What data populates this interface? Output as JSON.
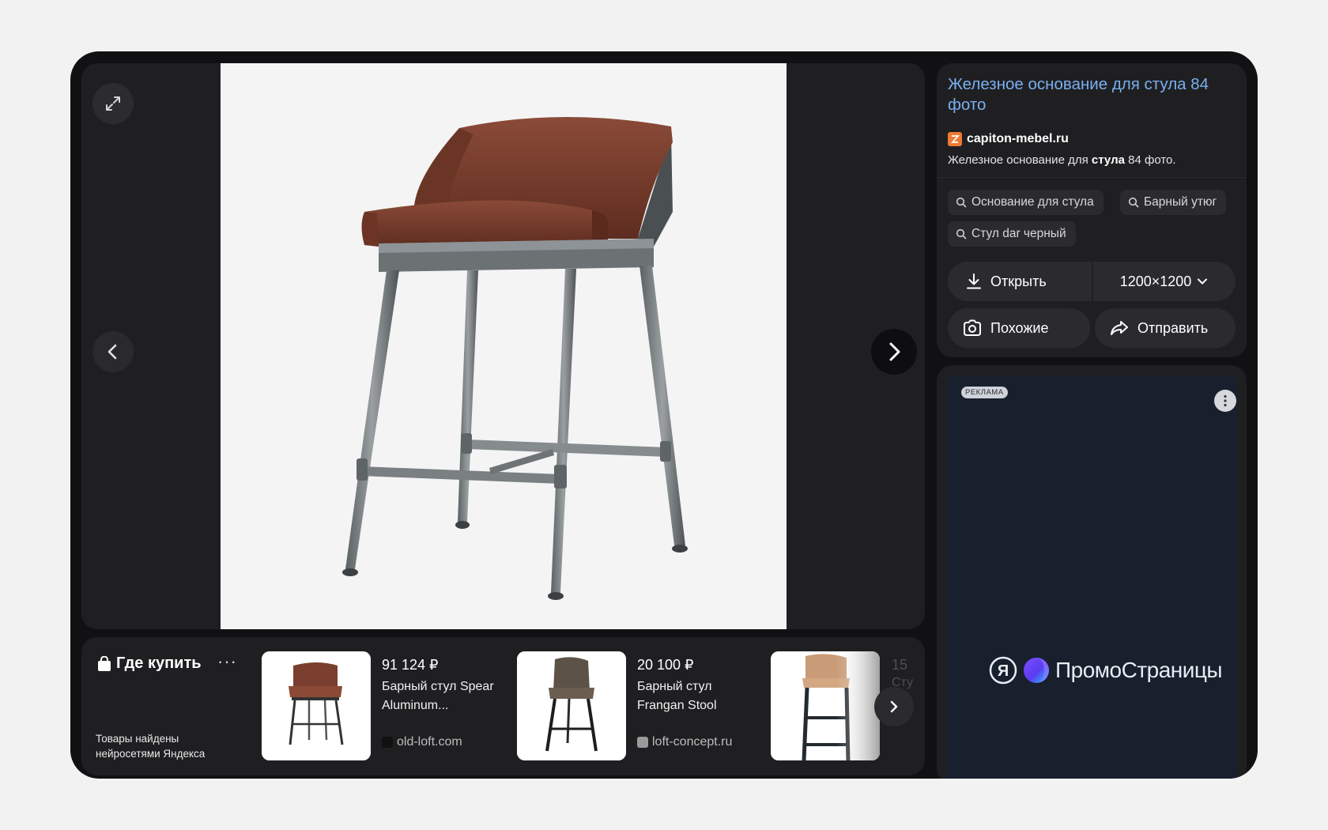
{
  "viewer": {
    "expand_icon": "expand-icon",
    "prev_icon": "chevron-left-icon",
    "next_icon": "chevron-right-icon"
  },
  "shopping": {
    "title": "Где купить",
    "more": "···",
    "note": "Товары найдены нейросетями Яндекса",
    "products": [
      {
        "price": "91 124 ₽",
        "name": "Барный стул Spear Aluminum...",
        "domain": "old-loft.com",
        "favicon_color": "#111111"
      },
      {
        "price": "20 100 ₽",
        "name": "Барный стул Frangan Stool",
        "domain": "loft-concept.ru",
        "favicon_color": "#9a9a9a"
      }
    ],
    "peek": {
      "price": "15",
      "name": "Сту"
    }
  },
  "info": {
    "title": "Железное основание для стула 84 фото",
    "source": "capiton-mebel.ru",
    "description_prefix": "Железное основание для ",
    "description_bold": "стула",
    "description_suffix": " 84 фото.",
    "chips": [
      "Основание для стула",
      "Барный утюг",
      "Стул dar черный"
    ],
    "open_label": "Открыть",
    "size_label": "1200×1200",
    "similar_label": "Похожие",
    "share_label": "Отправить"
  },
  "ad": {
    "badge": "РЕКЛАМА",
    "logo_letter": "Я",
    "logo_text": "ПромоСтраницы"
  },
  "colors": {
    "link": "#79b0ef",
    "panel": "#1f1f22",
    "window": "#111113",
    "ad_bg": "#18202e",
    "source_favicon": "#f07a32"
  }
}
